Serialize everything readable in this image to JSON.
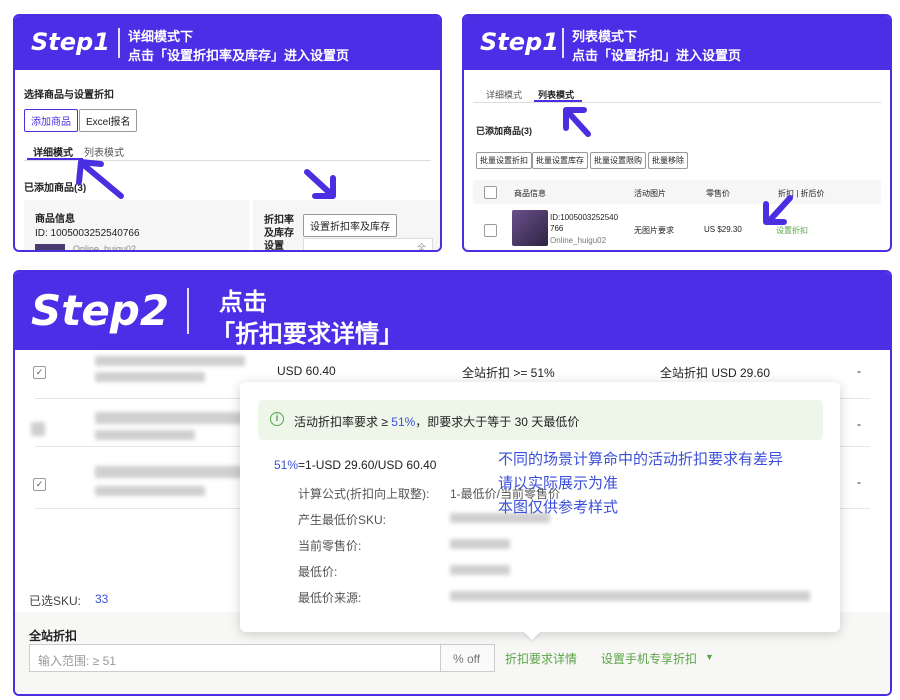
{
  "step1_left": {
    "step_label": "Step1",
    "line1": "详细模式下",
    "line2": "点击「设置折扣率及库存」进入设置页",
    "section_title": "选择商品与设置折扣",
    "add_product_btn": "添加商品",
    "excel_btn": "Excel报名",
    "tab_detail": "详细模式",
    "tab_list": "列表模式",
    "added_count": "已添加商品(3)",
    "product_info_header": "商品信息",
    "product_id": "ID: 1005003252540766",
    "store_name": "Online_huigu02",
    "discount_stock_label": "折扣率及库存设置",
    "set_discount_btn": "设置折扣率及库存",
    "all_label": "全"
  },
  "step1_right": {
    "step_label": "Step1",
    "line1": "列表模式下",
    "line2": "点击「设置折扣」进入设置页",
    "tab_detail": "详细模式",
    "tab_list": "列表模式",
    "added_count": "已添加商品(3)",
    "batch_buttons": [
      "批量设置折扣",
      "批量设置库存",
      "批量设置限购",
      "批量移除"
    ],
    "table_headers": [
      "商品信息",
      "活动图片",
      "零售价",
      "折扣 | 折后价"
    ],
    "product_id": "ID:1005003252540766",
    "store_name": "Online_huigu02",
    "image_value": "无图片要求",
    "price_value": "US $29.30",
    "set_discount_link": "设置折扣"
  },
  "step2": {
    "step_label": "Step2",
    "line1": "点击",
    "line2": "「折扣要求详情」"
  },
  "table": {
    "rows": [
      {
        "price": "USD 60.40",
        "rule": "全站折扣 >= 51%",
        "final": "全站折扣 USD 29.60",
        "dash": "-"
      },
      {
        "price": "",
        "rule": "",
        "final": "",
        "dash": "-"
      },
      {
        "price": "",
        "rule": "",
        "final": "",
        "dash": "-"
      }
    ]
  },
  "popup": {
    "note_prefix": "活动折扣率要求 ≥ ",
    "note_percent": "51%",
    "note_suffix": "，即要求大于等于 30 天最低价",
    "formula_percent": "51%",
    "formula_rest": "=1-USD 29.60/USD 60.40",
    "formula_label": "计算公式(折扣向上取整):",
    "formula_value": "1-最低价/当前零售价",
    "sku_label": "产生最低价SKU:",
    "current_price_label": "当前零售价:",
    "lowest_price_label": "最低价:",
    "source_label": "最低价来源:"
  },
  "annotation": {
    "line1": "不同的场景计算命中的活动折扣要求有差异",
    "line2": "请以实际展示为准",
    "line3": "本图仅供参考样式"
  },
  "footer": {
    "selected_sku_label": "已选SKU:",
    "selected_sku_count": "33",
    "site_discount_label": "全站折扣",
    "input_placeholder": "输入范围: ≥ 51",
    "input_suffix": "% off",
    "detail_link": "折扣要求详情",
    "mobile_link": "设置手机专享折扣",
    "mobile_arrow": "▼"
  },
  "colors": {
    "brand": "#4b2ee6",
    "green": "#5aa546",
    "blue_text": "#3b4fd8"
  }
}
